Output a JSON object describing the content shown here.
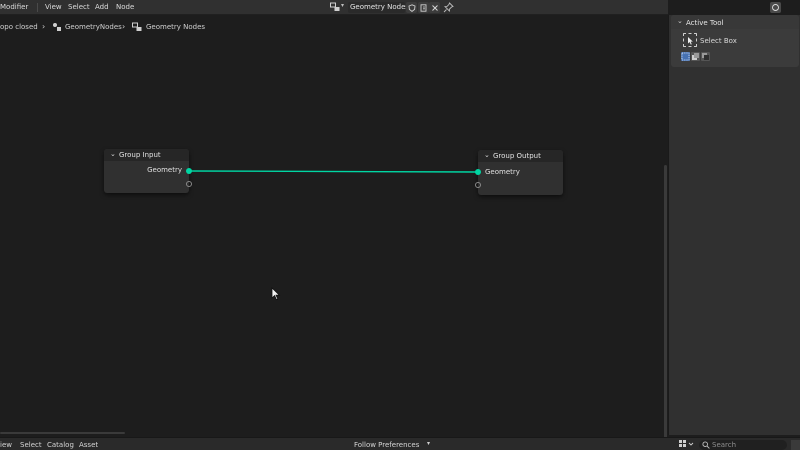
{
  "header": {
    "menu": [
      "Modifier",
      "View",
      "Select",
      "Add",
      "Node"
    ],
    "node_tree_name": "Geometry Nodes",
    "icons": [
      "node-tree-icon",
      "fake-user-icon",
      "duplicate-icon",
      "unlink-icon",
      "pin-icon"
    ]
  },
  "breadcrumb": {
    "object": "opo closed",
    "modifier": "GeometryNodes",
    "tree": "Geometry Nodes"
  },
  "nodes": {
    "group_input": {
      "title": "Group Input",
      "socket": "Geometry"
    },
    "group_output": {
      "title": "Group Output",
      "socket": "Geometry"
    },
    "link_color": "#00d6a3"
  },
  "sidebar": {
    "panel_title": "Active Tool",
    "tool_label": "Select Box",
    "accent": "#4772b3"
  },
  "asset_bar": {
    "menu": [
      "iew",
      "Select",
      "Catalog",
      "Asset"
    ],
    "preferences": "Follow Preferences",
    "search_placeholder": "Search"
  }
}
